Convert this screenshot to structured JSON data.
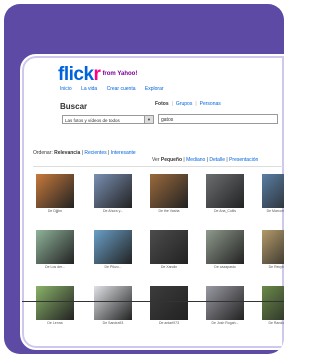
{
  "brand": {
    "name_blue": "flick",
    "name_pink": "r",
    "suffix": "from Yahoo!"
  },
  "top_nav": [
    "Inicio",
    "La vida",
    "Crear cuenta",
    "Explorar"
  ],
  "search": {
    "title": "Buscar",
    "tabs": [
      "Fotos",
      "Grupos",
      "Personas"
    ],
    "scope": "Las fotos y vídeos de todos",
    "query": "gatos"
  },
  "sort": {
    "prefix": "Ordenar:",
    "options": [
      "Relevancia",
      "Recientes",
      "Interesante"
    ]
  },
  "view": {
    "prefix": "Ver",
    "options": [
      "Pequeño",
      "Mediano",
      "Detalle",
      "Presentación"
    ]
  },
  "results": [
    {
      "caption": "De Djjjbn",
      "color": "#c87a3c"
    },
    {
      "caption": "De Ahora y...",
      "color": "#7a8fb3"
    },
    {
      "caption": "De the Vasha",
      "color": "#9a6a3c"
    },
    {
      "caption": "De Ana_Cullis",
      "color": "#6b6e70"
    },
    {
      "caption": "De Marcomonarca",
      "color": "#5a7ea3"
    },
    {
      "caption": "De Los der...",
      "color": "#8fb39a"
    },
    {
      "caption": "De Pikvo...",
      "color": "#6aa0c8"
    },
    {
      "caption": "De Xandin",
      "color": "#4c4c4c"
    },
    {
      "caption": "De cazapasto",
      "color": "#8f9a8c"
    },
    {
      "caption": "De Recyb Oroci",
      "color": "#b39a6a"
    },
    {
      "caption": "De Lenna",
      "color": "#8ab36a"
    },
    {
      "caption": "De Sandra93",
      "color": "#e0e2e6"
    },
    {
      "caption": "De antari973",
      "color": "#3c3c3c"
    },
    {
      "caption": "De Josh Rogah...",
      "color": "#9a9aa3"
    },
    {
      "caption": "De Rando Oroci",
      "color": "#6a8a4a"
    }
  ]
}
